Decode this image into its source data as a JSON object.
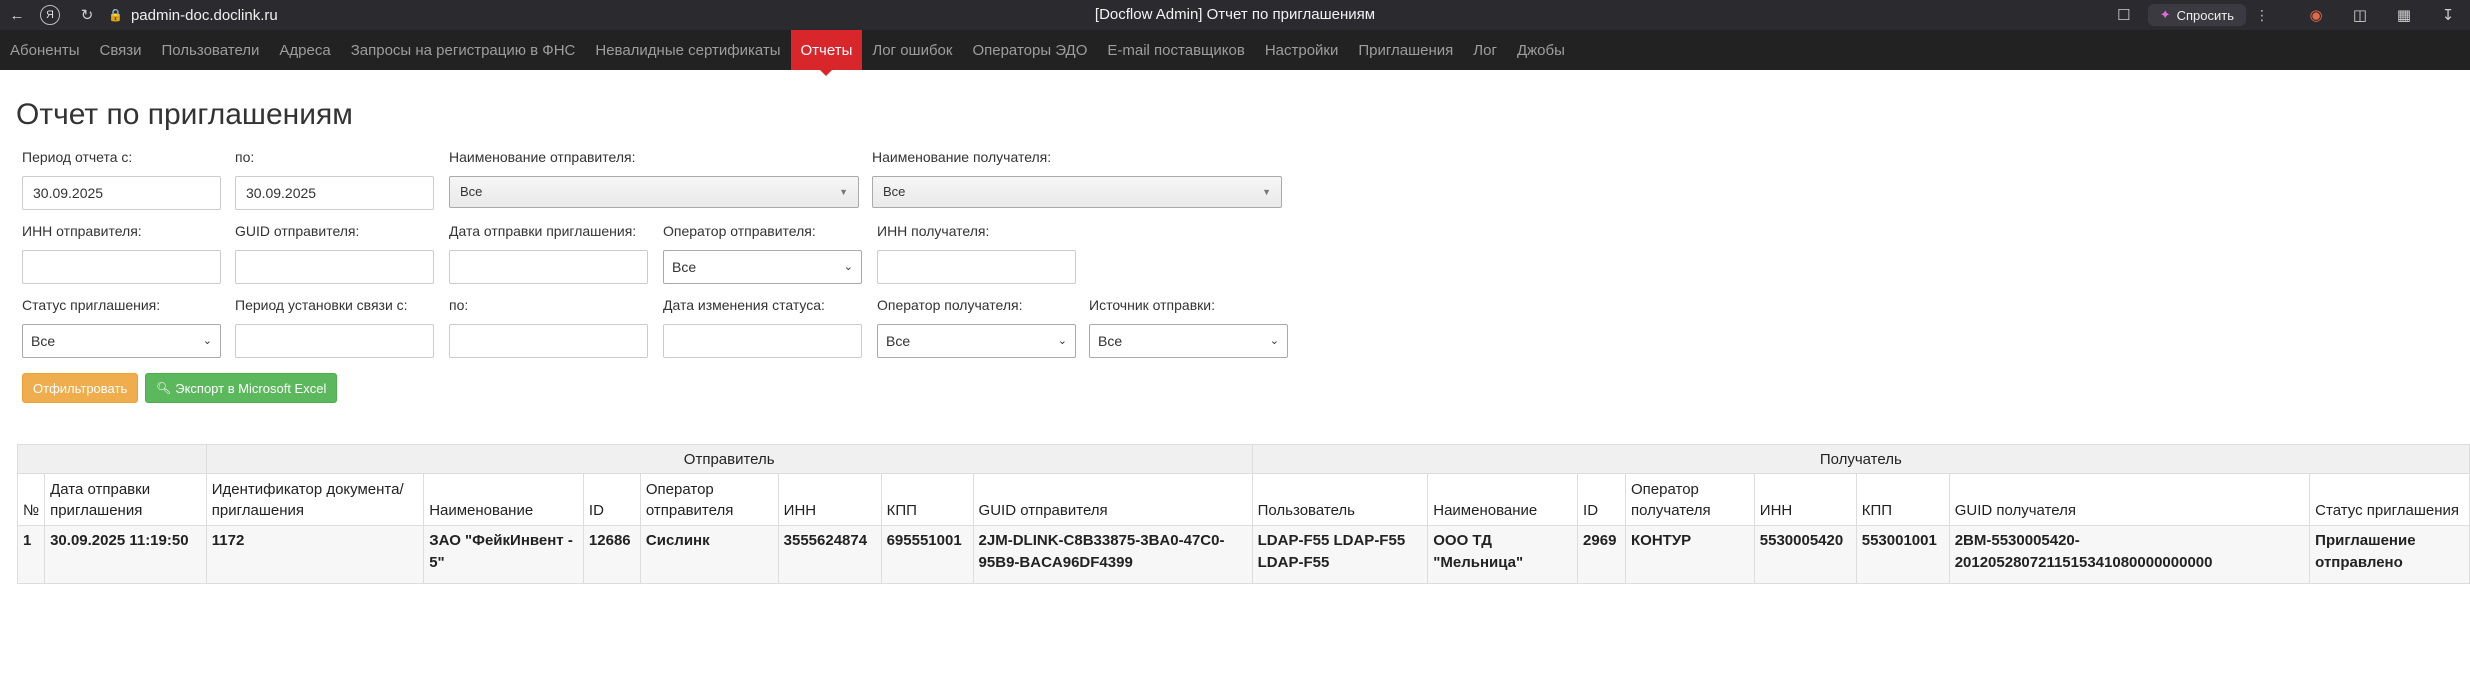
{
  "browser": {
    "url": "padmin-doc.doclink.ru",
    "title": "[Docflow Admin] Отчет по приглашениям",
    "ask_label": "Спросить"
  },
  "nav": {
    "items": [
      {
        "label": "Абоненты",
        "w": 78
      },
      {
        "label": "Связи",
        "w": 52
      },
      {
        "label": "Пользователи",
        "w": 110
      },
      {
        "label": "Адреса",
        "w": 63
      },
      {
        "label": "Запросы на регистрацию в ФНС",
        "w": 234
      },
      {
        "label": "Невалидные сертификаты",
        "w": 195
      },
      {
        "label": "Отчеты",
        "w": 70,
        "active": true
      },
      {
        "label": "Лог ошибок",
        "w": 99
      },
      {
        "label": "Операторы ЭДО",
        "w": 118
      },
      {
        "label": "E-mail поставщиков",
        "w": 158
      },
      {
        "label": "Настройки",
        "w": 92
      },
      {
        "label": "Приглашения",
        "w": 104
      },
      {
        "label": "Лог",
        "w": 32
      },
      {
        "label": "Джобы",
        "w": 60
      }
    ]
  },
  "page": {
    "title": "Отчет по приглашениям"
  },
  "filters": {
    "period_from_label": "Период отчета с:",
    "period_from_value": "30.09.2025",
    "period_to_label": "по:",
    "period_to_value": "30.09.2025",
    "sender_name_label": "Наименование отправителя:",
    "sender_name_value": "Все",
    "receiver_name_label": "Наименование получателя:",
    "receiver_name_value": "Все",
    "sender_inn_label": "ИНН отправителя:",
    "sender_guid_label": "GUID отправителя:",
    "invite_date_label": "Дата отправки приглашения:",
    "sender_operator_label": "Оператор отправителя:",
    "sender_operator_value": "Все",
    "receiver_inn_label": "ИНН получателя:",
    "invite_status_label": "Статус приглашения:",
    "invite_status_value": "Все",
    "link_period_label": "Период установки связи с:",
    "link_period_to_label": "по:",
    "status_change_date_label": "Дата изменения статуса:",
    "receiver_operator_label": "Оператор получателя:",
    "receiver_operator_value": "Все",
    "send_source_label": "Источник отправки:",
    "send_source_value": "Все",
    "filter_button": "Отфильтровать",
    "export_button": "Экспорт в Microsoft Excel"
  },
  "table": {
    "group_sender": "Отправитель",
    "group_receiver": "Получатель",
    "columns": [
      "№",
      "Дата отправки приглашения",
      "Идентификатор документа/ приглашения",
      "Наименование",
      "ID",
      "Оператор отправителя",
      "ИНН",
      "КПП",
      "GUID отправителя",
      "Пользователь",
      "Наименование",
      "ID",
      "Оператор получателя",
      "ИНН",
      "КПП",
      "GUID получателя",
      "Статус приглашения"
    ],
    "rows": [
      [
        "1",
        "30.09.2025 11:19:50",
        "1172",
        "ЗАО \"ФейкИнвент - 5\"",
        "12686",
        "Сислинк",
        "3555624874",
        "695551001",
        "2JM-DLINK-C8B33875-3BA0-47C0-95B9-BACA96DF4399",
        "LDAP-F55 LDAP-F55 LDAP-F55",
        "ООО ТД \"Мельница\"",
        "2969",
        "КОНТУР",
        "5530005420",
        "553001001",
        "2BM-5530005420-2012052807211515341080000000000",
        "Приглашение отправлено"
      ]
    ]
  }
}
